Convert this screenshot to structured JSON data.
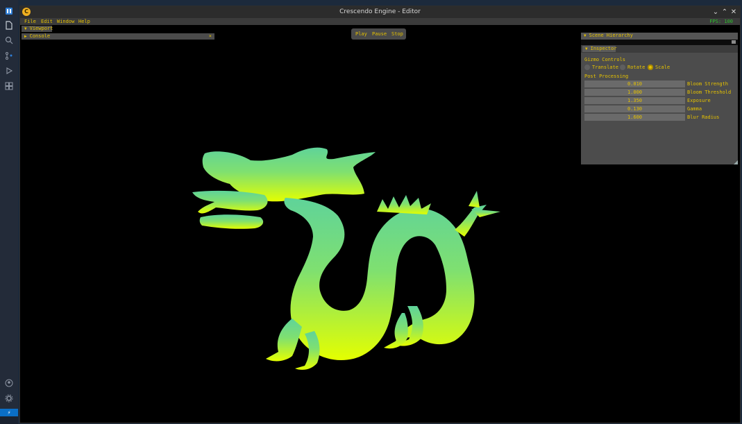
{
  "window": {
    "title": "Crescendo Engine - Editor",
    "app_icon": "crescendo-logo",
    "controls": [
      "chevron-down-icon",
      "chevron-up-icon",
      "close-icon"
    ]
  },
  "menu": {
    "items": [
      "File",
      "Edit",
      "Window",
      "Help"
    ],
    "fps": "FPS: 100"
  },
  "panels": {
    "viewport_tab": "Viewport",
    "console_tab": "Console",
    "console_close": "×",
    "hierarchy_tab": "Scene Hierarchy",
    "inspector_tab": "Inspector"
  },
  "playbar": {
    "play": "Play",
    "pause": "Pause",
    "stop": "Stop"
  },
  "inspector": {
    "gizmo_heading": "Gizmo Controls",
    "gizmo_options": [
      {
        "label": "Translate",
        "selected": false
      },
      {
        "label": "Rotate",
        "selected": false
      },
      {
        "label": "Scale",
        "selected": true
      }
    ],
    "post_heading": "Post Processing",
    "params": [
      {
        "label": "Bloom Strength",
        "value": "0.010"
      },
      {
        "label": "Bloom Threshold",
        "value": "1.000"
      },
      {
        "label": "Exposure",
        "value": "1.350"
      },
      {
        "label": "Gamma",
        "value": "0.130"
      },
      {
        "label": "Blur Radius",
        "value": "1.600"
      }
    ]
  },
  "scene": {
    "model": "dragon",
    "gradient_top": "#5fd39a",
    "gradient_bottom": "#e4ff00"
  },
  "activity_bar": {
    "icons": [
      "explorer-icon",
      "files-icon",
      "search-icon",
      "source-control-icon",
      "run-debug-icon",
      "extensions-icon",
      "account-icon",
      "settings-icon"
    ]
  },
  "colors": {
    "accent": "#e6c200",
    "fps": "#2cc22c",
    "status_bar": "#0b6fc7"
  }
}
